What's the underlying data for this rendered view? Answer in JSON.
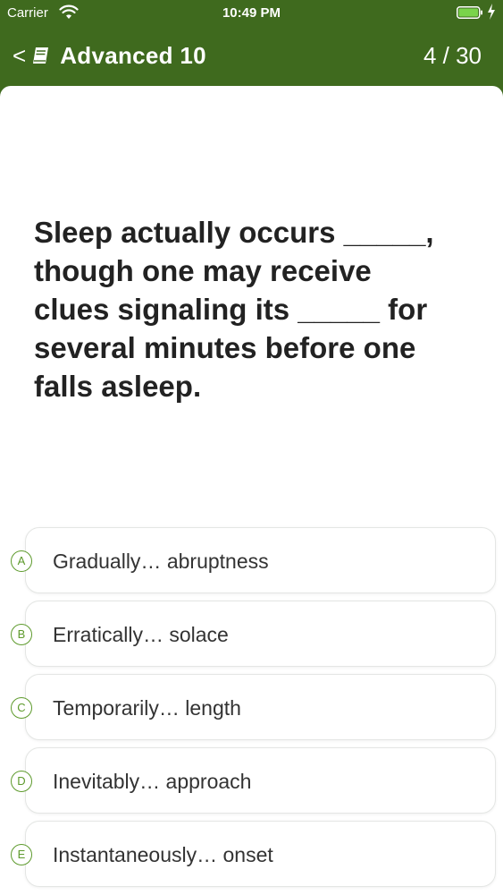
{
  "status": {
    "carrier": "Carrier",
    "time": "10:49 PM",
    "battery_color": "#7ad34a"
  },
  "nav": {
    "back_glyph": "<",
    "title": "Advanced 10",
    "progress": "4 / 30",
    "bar_color": "#3f6a1e"
  },
  "question": {
    "text": "Sleep actually occurs _____, though one may receive clues signaling its _____ for several minutes before one falls asleep."
  },
  "options": [
    {
      "letter": "A",
      "text": "Gradually… abruptness"
    },
    {
      "letter": "B",
      "text": "Erratically… solace"
    },
    {
      "letter": "C",
      "text": "Temporarily… length"
    },
    {
      "letter": "D",
      "text": "Inevitably… approach"
    },
    {
      "letter": "E",
      "text": "Instantaneously… onset"
    }
  ],
  "accent_color": "#5d9a2c"
}
